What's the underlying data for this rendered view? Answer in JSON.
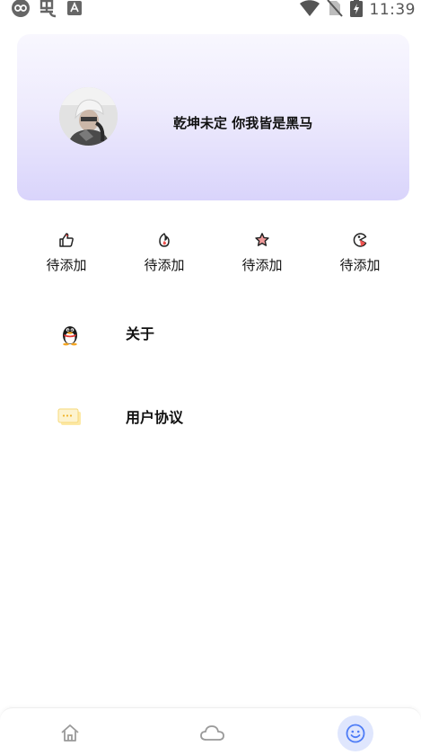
{
  "status_bar": {
    "time": "11:39",
    "icons": [
      "infinity-icon",
      "app-icon",
      "a-icon",
      "wifi-icon",
      "no-sim-icon",
      "battery-charging-icon"
    ]
  },
  "profile": {
    "name": "乾坤未定 你我皆是黑马",
    "avatar": "avatar"
  },
  "stats": [
    {
      "icon": "thumbs-up-icon",
      "label": "待添加"
    },
    {
      "icon": "flame-icon",
      "label": "待添加"
    },
    {
      "icon": "star-icon",
      "label": "待添加"
    },
    {
      "icon": "pacman-icon",
      "label": "待添加"
    }
  ],
  "menu": [
    {
      "icon": "qq-penguin-icon",
      "label": "关于"
    },
    {
      "icon": "message-icon",
      "label": "用户协议"
    }
  ],
  "bottom_nav": {
    "tabs": [
      {
        "icon": "home-icon",
        "active": false
      },
      {
        "icon": "cloud-icon",
        "active": false
      },
      {
        "icon": "smiley-icon",
        "active": true
      }
    ]
  },
  "colors": {
    "card_gradient_top": "#f8f7fe",
    "card_gradient_bottom": "#d9d4fb",
    "nav_active_bg": "#dfe6fd",
    "nav_active_icon": "#4e7cf6",
    "nav_inactive_icon": "#9a9a9a"
  }
}
